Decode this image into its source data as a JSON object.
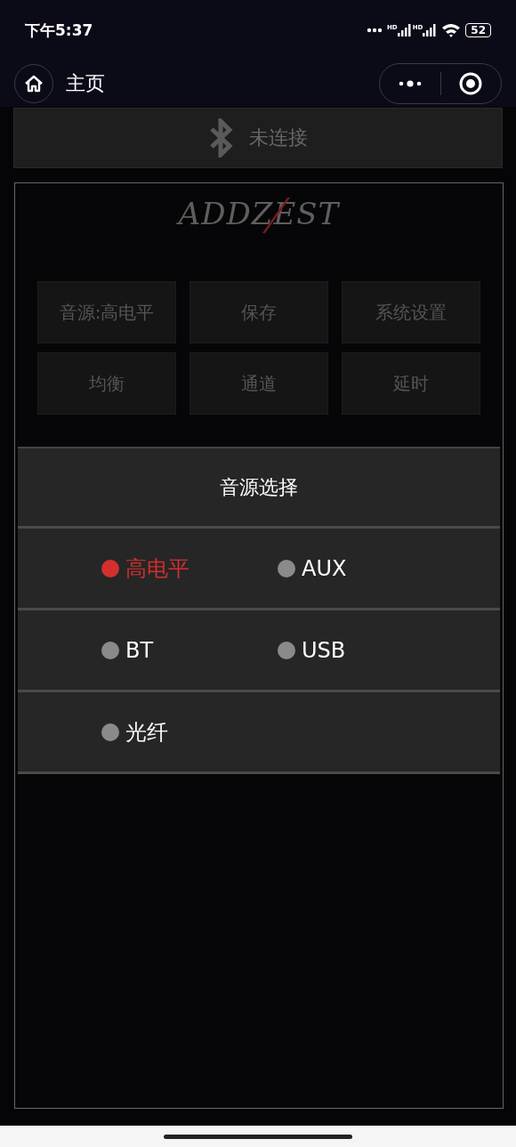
{
  "status_bar": {
    "time": "下午5:37",
    "signal_labels": [
      "HD",
      "HD"
    ],
    "battery": "52"
  },
  "nav_bar": {
    "title": "主页"
  },
  "bluetooth": {
    "label": "未连接"
  },
  "logo": "ADDZEST",
  "buttons": [
    "音源:高电平",
    "保存",
    "系统设置",
    "均衡",
    "通道",
    "延时"
  ],
  "source_dialog": {
    "title": "音源选择",
    "options": [
      {
        "label": "高电平",
        "selected": true
      },
      {
        "label": "AUX",
        "selected": false
      },
      {
        "label": "BT",
        "selected": false
      },
      {
        "label": "USB",
        "selected": false
      },
      {
        "label": "光纤",
        "selected": false
      }
    ]
  }
}
